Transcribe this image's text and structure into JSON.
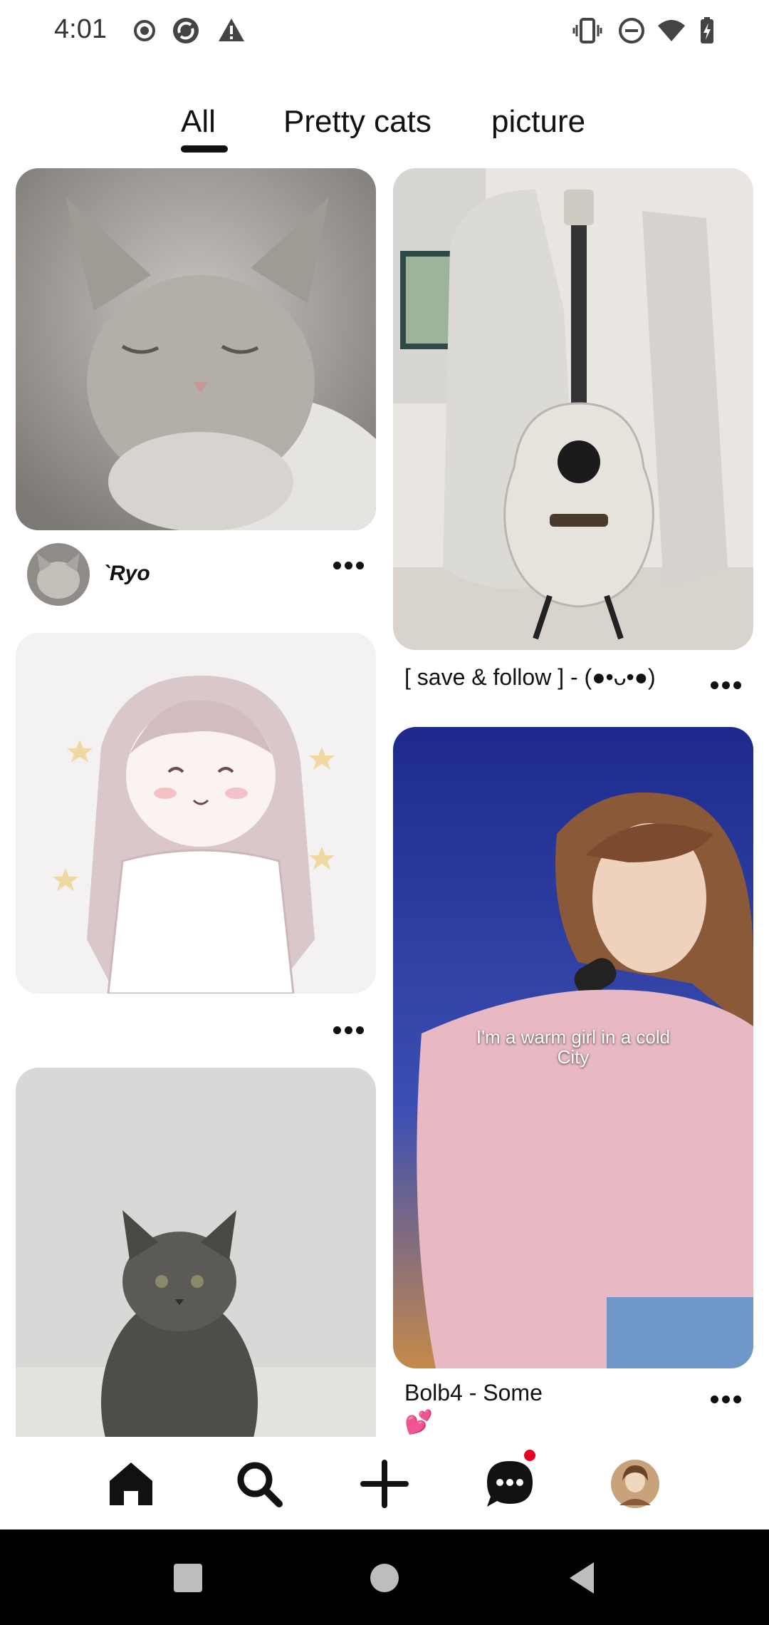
{
  "status_bar": {
    "time": "4:01",
    "left_icons": [
      "record-icon",
      "sync-icon",
      "warning-icon"
    ],
    "right_icons": [
      "vibrate-icon",
      "do-not-disturb-icon",
      "wifi-icon",
      "battery-icon"
    ]
  },
  "tabs": {
    "items": [
      {
        "label": "All",
        "selected": true
      },
      {
        "label": "Pretty cats",
        "selected": false
      },
      {
        "label": "picture",
        "selected": false
      }
    ]
  },
  "feed": {
    "left_column": [
      {
        "image": "sleeping-white-kitten-photo",
        "author": "`Ryo",
        "more": "more-options-icon"
      },
      {
        "image": "anime-girl-drawing",
        "more": "more-options-icon"
      },
      {
        "image": "fluffy-gray-kitten-photo"
      }
    ],
    "right_column": [
      {
        "image": "white-acoustic-guitar-photo",
        "caption": "[ save & follow ] - (●•ᴗ•●)",
        "more": "more-options-icon"
      },
      {
        "image": "singer-with-microphone-video",
        "overlay_line1": "I'm a warm girl in a cold",
        "overlay_line2": "City",
        "caption": "Bolb4 - Some",
        "caption_emoji": "💕",
        "more": "more-options-icon"
      }
    ]
  },
  "bottom_nav": {
    "items": [
      "home-icon",
      "search-icon",
      "create-plus-icon",
      "messages-icon",
      "profile-avatar"
    ],
    "active": "home-icon",
    "notification_badge_color": "#e60023"
  },
  "system_nav": [
    "recents-square-icon",
    "home-circle-icon",
    "back-triangle-icon"
  ]
}
